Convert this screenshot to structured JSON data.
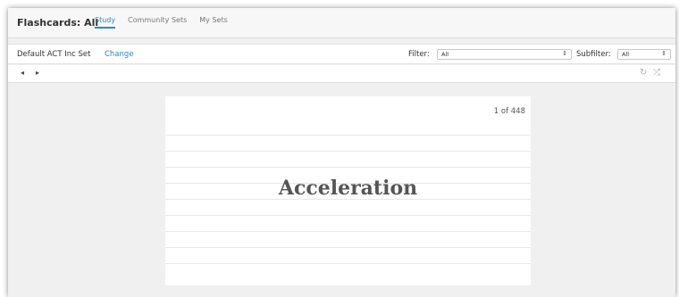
{
  "app": {
    "title": "Flashcards: All"
  },
  "tabs": [
    {
      "label": "Study",
      "active": true
    },
    {
      "label": "Community Sets",
      "active": false
    },
    {
      "label": "My Sets",
      "active": false
    }
  ],
  "toolbar": {
    "set_name": "Default ACT Inc Set",
    "change_label": "Change",
    "filter_label": "Filter:",
    "filter_value": "All",
    "subfilter_label": "Subfilter:",
    "subfilter_value": "All"
  },
  "nav": {
    "prev_icon": "◂",
    "next_icon": "▸",
    "refresh_icon": "↻",
    "shuffle_icon": "⤮"
  },
  "card": {
    "counter": "1 of 448",
    "term": "Acceleration"
  },
  "colors": {
    "accent": "#2a8ac7",
    "background": "#f0f0f0",
    "card": "#ffffff"
  }
}
